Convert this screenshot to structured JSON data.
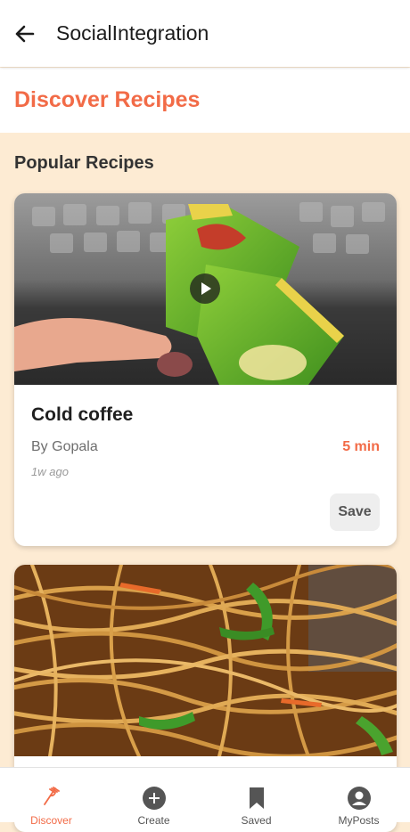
{
  "appbar": {
    "title": "SocialIntegration"
  },
  "header": {
    "title": "Discover Recipes"
  },
  "section": {
    "title": "Popular Recipes"
  },
  "recipes": [
    {
      "title": "Cold coffee",
      "author": "By Gopala",
      "time": "5 min",
      "ago": "1w ago",
      "save_label": "Save",
      "has_video": true
    },
    {
      "title": "",
      "author": "",
      "time": "",
      "ago": "",
      "has_video": false
    }
  ],
  "nav": [
    {
      "label": "Discover",
      "icon": "fork-icon",
      "active": true
    },
    {
      "label": "Create",
      "icon": "plus-circle-icon",
      "active": false
    },
    {
      "label": "Saved",
      "icon": "bookmark-icon",
      "active": false
    },
    {
      "label": "MyPosts",
      "icon": "account-icon",
      "active": false
    }
  ],
  "colors": {
    "accent": "#f26b47",
    "background": "#fdebd3",
    "card": "#ffffff"
  }
}
